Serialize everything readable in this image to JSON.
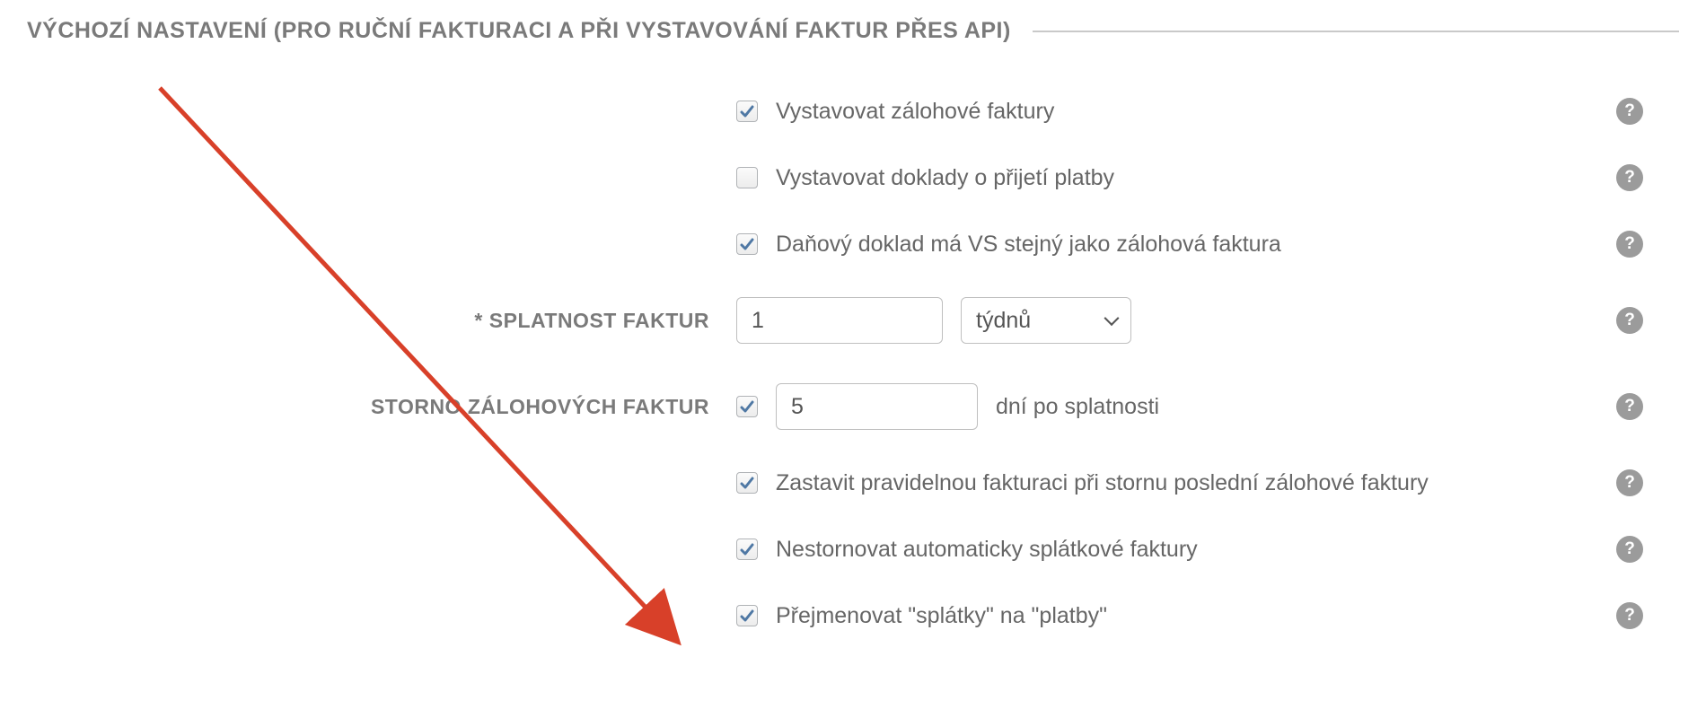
{
  "section_title": "VÝCHOZÍ NASTAVENÍ (PRO RUČNÍ FAKTURACI A PŘI VYSTAVOVÁNÍ FAKTUR PŘES API)",
  "rows": {
    "proforma": {
      "checked": true,
      "label": "Vystavovat zálohové faktury"
    },
    "receipts": {
      "checked": false,
      "label": "Vystavovat doklady o přijetí platby"
    },
    "vs_same": {
      "checked": true,
      "label": "Daňový doklad má VS stejný jako zálohová faktura"
    },
    "due": {
      "left_label": "* SPLATNOST FAKTUR",
      "value": "1",
      "unit": "týdnů"
    },
    "storno": {
      "left_label": "STORNO ZÁLOHOVÝCH FAKTUR",
      "checked": true,
      "days": "5",
      "suffix": "dní po splatnosti"
    },
    "stop": {
      "checked": true,
      "label": "Zastavit pravidelnou fakturaci při stornu poslední zálohové faktury"
    },
    "nostorno": {
      "checked": true,
      "label": "Nestornovat automaticky splátkové faktury"
    },
    "rename": {
      "checked": true,
      "label": "Přejmenovat \"splátky\" na \"platby\""
    }
  },
  "help_glyph": "?",
  "colors": {
    "arrow": "#d84029"
  }
}
